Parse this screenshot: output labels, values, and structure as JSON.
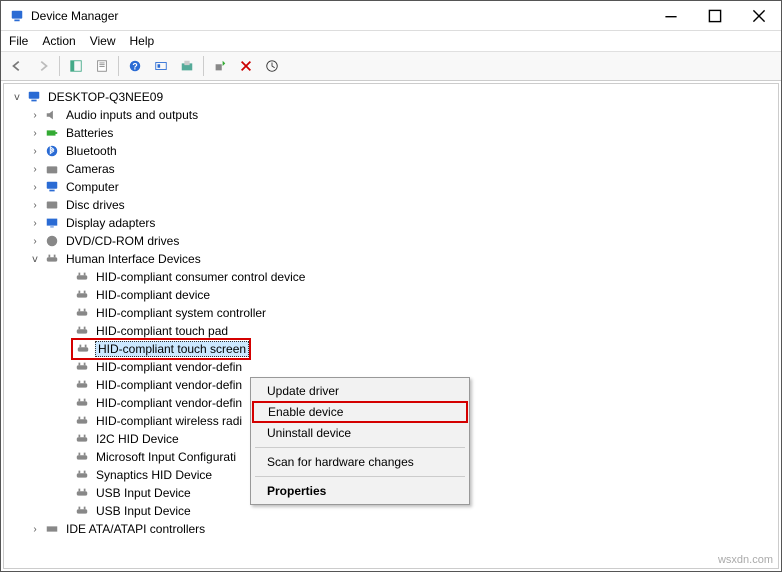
{
  "window": {
    "title": "Device Manager"
  },
  "menubar": [
    "File",
    "Action",
    "View",
    "Help"
  ],
  "context_menu": {
    "items": [
      "Update driver",
      "Enable device",
      "Uninstall device",
      "Scan for hardware changes",
      "Properties"
    ]
  },
  "tree": {
    "root": "DESKTOP-Q3NEE09",
    "categories": [
      {
        "label": "Audio inputs and outputs",
        "icon": "speaker"
      },
      {
        "label": "Batteries",
        "icon": "battery"
      },
      {
        "label": "Bluetooth",
        "icon": "bluetooth"
      },
      {
        "label": "Cameras",
        "icon": "camera"
      },
      {
        "label": "Computer",
        "icon": "computer"
      },
      {
        "label": "Disc drives",
        "icon": "disk"
      },
      {
        "label": "Display adapters",
        "icon": "display"
      },
      {
        "label": "DVD/CD-ROM drives",
        "icon": "dvd"
      }
    ],
    "hid_label": "Human Interface Devices",
    "hid_children": [
      "HID-compliant consumer control device",
      "HID-compliant device",
      "HID-compliant system controller",
      "HID-compliant touch pad",
      "HID-compliant touch screen",
      "HID-compliant vendor-defin",
      "HID-compliant vendor-defin",
      "HID-compliant vendor-defin",
      "HID-compliant wireless radi",
      "I2C HID Device",
      "Microsoft Input Configurati",
      "Synaptics HID Device",
      "USB Input Device",
      "USB Input Device"
    ],
    "tail": "IDE ATA/ATAPI controllers"
  },
  "watermark": "wsxdn.com"
}
